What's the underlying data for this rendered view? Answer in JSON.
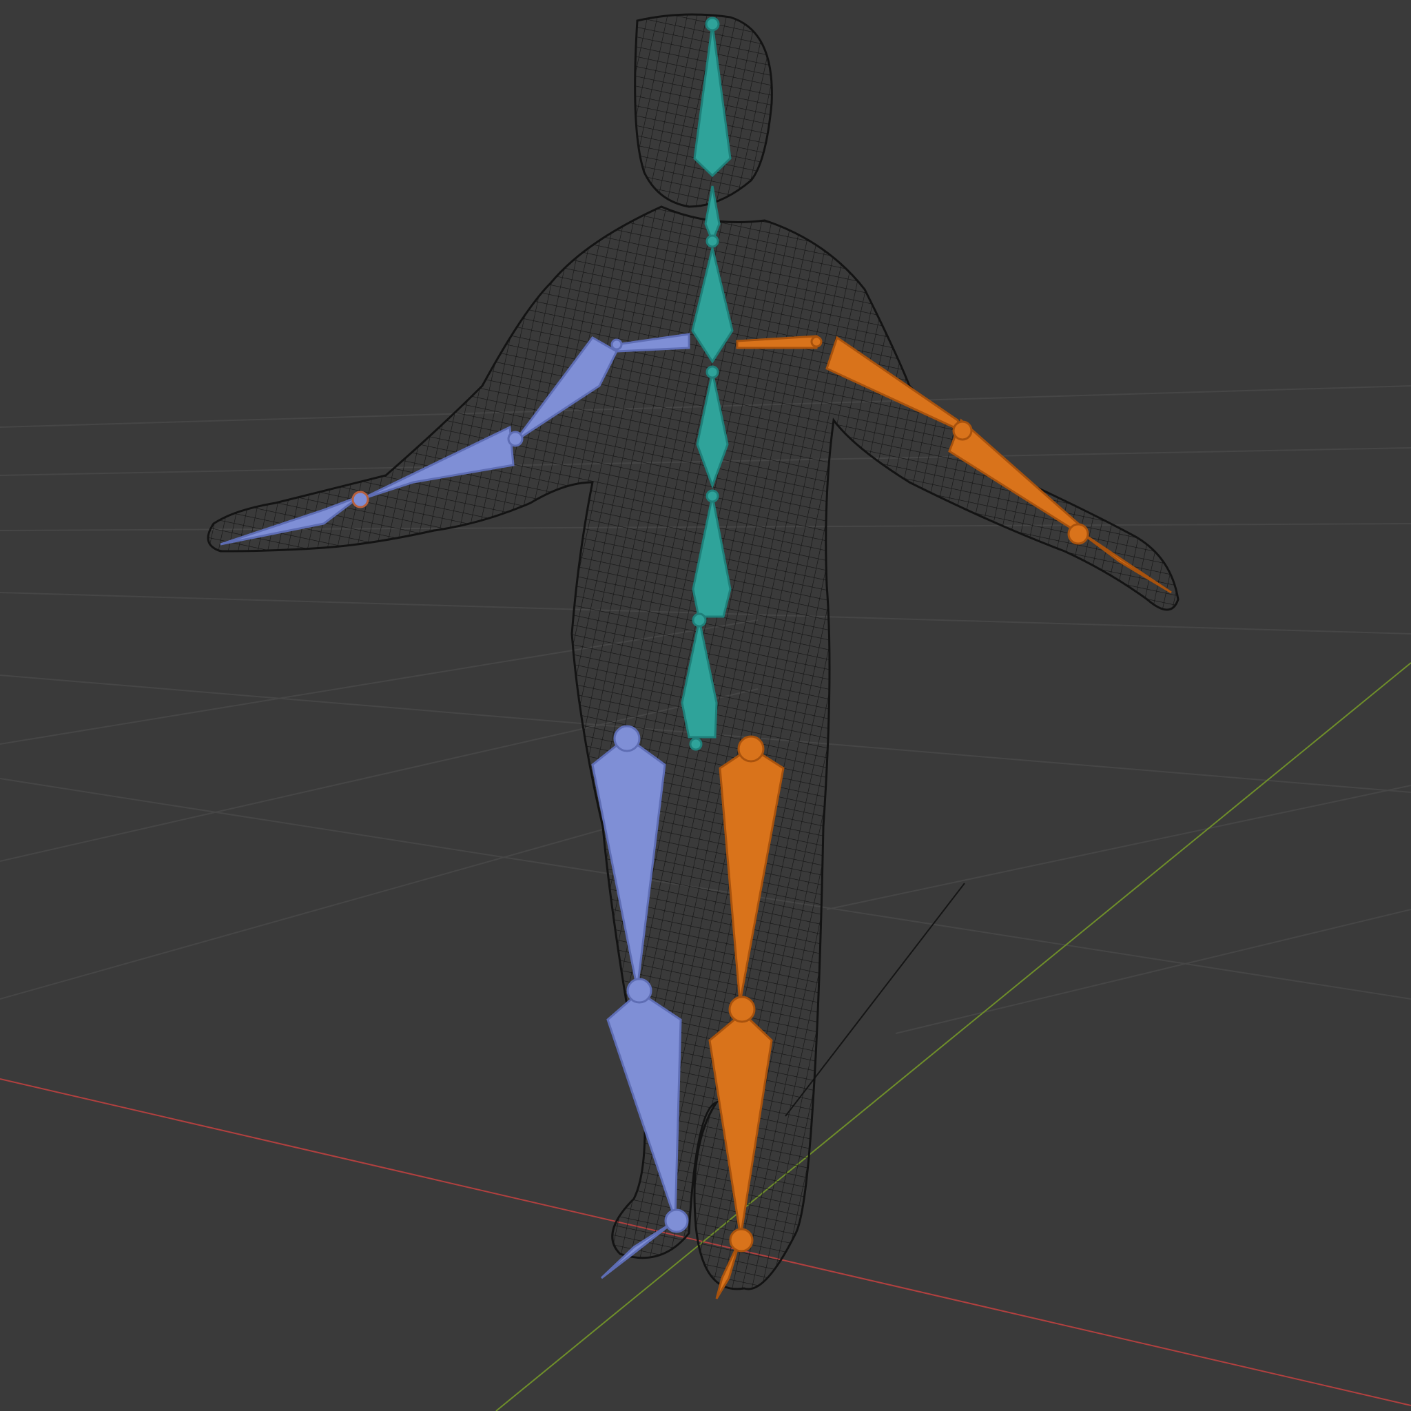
{
  "viewport": {
    "background": "#3a3a3a",
    "grid_color": "#464646",
    "x_axis_color": "#b2403f",
    "y_axis_color": "#6f8f2a",
    "show_floor_grid": true,
    "show_axes": true
  },
  "scene": {
    "mesh": {
      "display": "wireframe",
      "wire_color": "#111111"
    },
    "armature": {
      "center_bone_color": "#2fa39a",
      "left_bone_color": "#7f8fd6",
      "right_bone_color": "#d9731b",
      "bone_display": "octahedral"
    }
  }
}
